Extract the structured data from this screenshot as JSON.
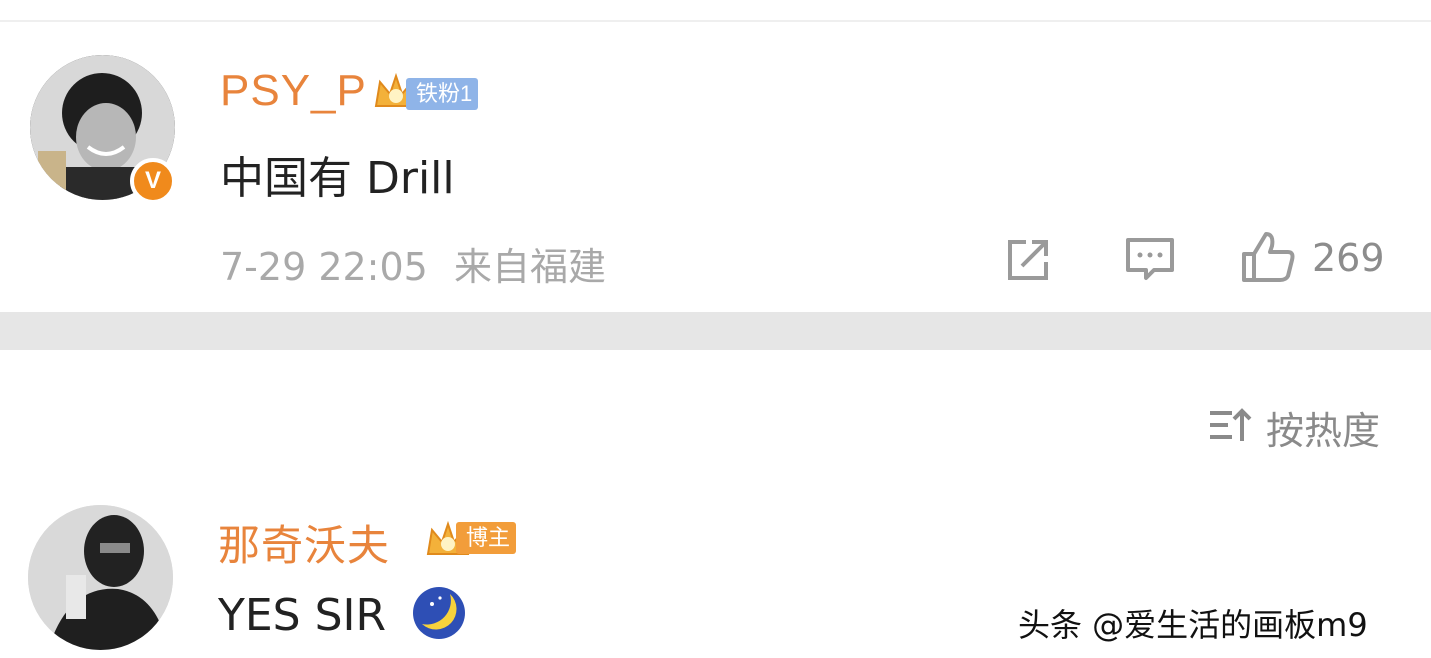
{
  "comments": [
    {
      "username": "PSY_P",
      "fan_badge": "铁粉1",
      "text": "中国有 Drill",
      "time": "7-29 22:05",
      "location": "来自福建",
      "likes": "269"
    },
    {
      "username": "那奇沃夫",
      "fan_badge": "博主",
      "text": "YES SIR"
    }
  ],
  "sort": {
    "label": "按热度"
  },
  "watermark": "头条 @爱生活的画板m9",
  "colors": {
    "username": "#e8843c",
    "meta_text": "#a9a9a9",
    "iron_fan_badge": "#8fb4e8",
    "author_badge": "#f29d3a",
    "verified_badge": "#f08a1c"
  }
}
